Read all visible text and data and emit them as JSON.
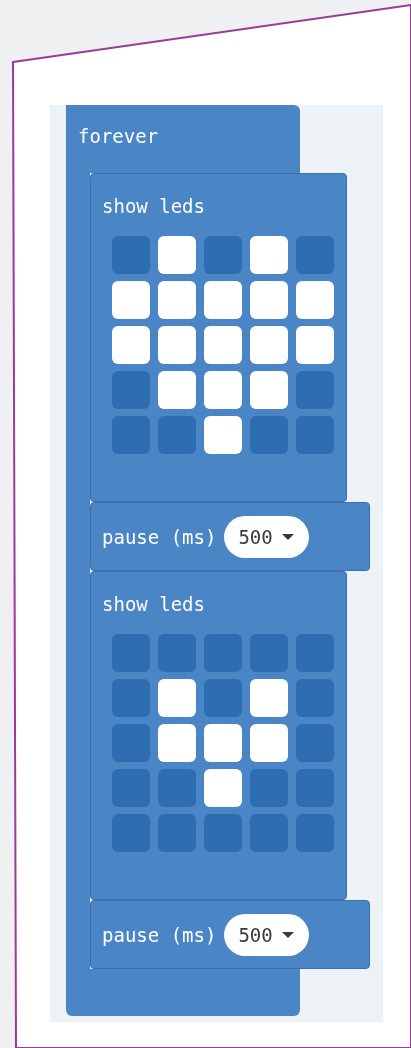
{
  "blocks": [
    {
      "kind": "forever",
      "label": "forever",
      "children": [
        {
          "kind": "show_leds",
          "label": "show leds",
          "leds": [
            [
              false,
              true,
              false,
              true,
              false
            ],
            [
              true,
              true,
              true,
              true,
              true
            ],
            [
              true,
              true,
              true,
              true,
              true
            ],
            [
              false,
              true,
              true,
              true,
              false
            ],
            [
              false,
              false,
              true,
              false,
              false
            ]
          ]
        },
        {
          "kind": "pause",
          "label": "pause (ms)",
          "value": "500"
        },
        {
          "kind": "show_leds",
          "label": "show leds",
          "leds": [
            [
              false,
              false,
              false,
              false,
              false
            ],
            [
              false,
              true,
              false,
              true,
              false
            ],
            [
              false,
              true,
              true,
              true,
              false
            ],
            [
              false,
              false,
              true,
              false,
              false
            ],
            [
              false,
              false,
              false,
              false,
              false
            ]
          ]
        },
        {
          "kind": "pause",
          "label": "pause (ms)",
          "value": "500"
        }
      ]
    }
  ]
}
